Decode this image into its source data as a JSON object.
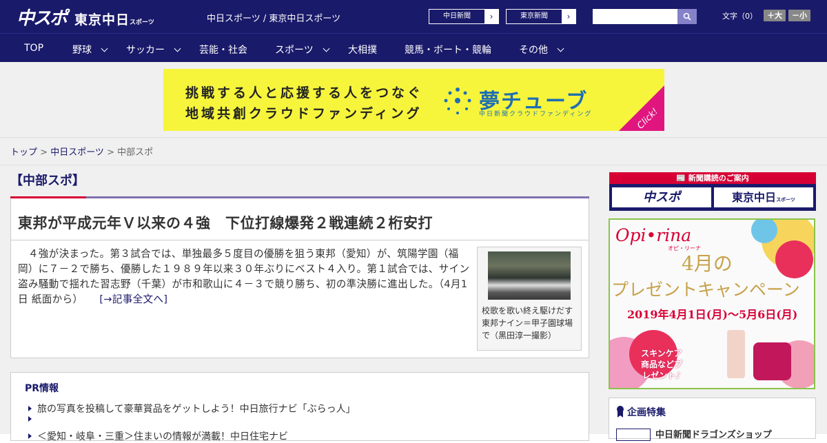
{
  "header": {
    "logo_main": "中スポ",
    "logo_sub": "東京中日",
    "logo_sub2": "スポーツ",
    "title": "中日スポーツ / 東京中日スポーツ",
    "btn1": "中日新聞",
    "btn2": "東京新聞",
    "font_label": "文字（0）",
    "font_big": "＋大",
    "font_small": "－小"
  },
  "nav": {
    "items": [
      "TOP",
      "野球",
      "サッカー",
      "芸能・社会",
      "スポーツ",
      "大相撲",
      "競馬・ボート・競輪",
      "その他"
    ]
  },
  "banner": {
    "line1": "挑戦する人と応援する人をつなぐ",
    "line2": "地域共創クラウドファンディング",
    "logo": "夢チューブ",
    "logo_sub": "中日新聞クラウドファンディング",
    "click": "Click!"
  },
  "breadcrumb": {
    "top": "トップ",
    "sep": " > ",
    "chunichi": "中日スポーツ",
    "current": "中部スポ"
  },
  "article": {
    "section": "【中部スポ】",
    "headline": "東邦が平成元年Ｖ以来の４強　下位打線爆発２戦連続２桁安打",
    "body": "　４強が決まった。第３試合では、単独最多５度目の優勝を狙う東邦（愛知）が、筑陽学園（福岡）に７－２で勝ち、優勝した１９８９年以来３０年ぶりにベスト４入り。第１試合では、サイン盗み騒動で揺れた習志野（千葉）が市和歌山に４－３で競り勝ち、初の準決勝に進出した。（4月1日 紙面から）",
    "more": "[→記事全文へ]",
    "caption": "校歌を歌い終え駆けだす東邦ナイン＝甲子園球場で（黒田淳一撮影）"
  },
  "pr": {
    "title": "PR情報",
    "items": [
      "旅の写真を投稿して豪華賞品をゲットしよう！中日旅行ナビ「ぶらっ人」",
      "",
      "＜愛知・岐阜・三重＞住まいの情報が満載！中日住宅ナビ"
    ]
  },
  "sidebar": {
    "subscribe": "新聞購読のご案内",
    "sub_btn1": "中スポ",
    "sub_btn2": "東京中日",
    "sub_btn2_small": "スポーツ",
    "promo_brand": "Opi•rina",
    "promo_brand_sub": "オピ・リーナ",
    "promo_month": "4月の",
    "promo_title": "プレゼントキャンペーン",
    "promo_dates": "2019年4月1日(月)～5月6日(月)",
    "promo_gift": "スキンケア商品などプレゼント♪",
    "kikaku_title": "企画特集",
    "kikaku_item": "中日新聞ドラゴンズショップ"
  }
}
